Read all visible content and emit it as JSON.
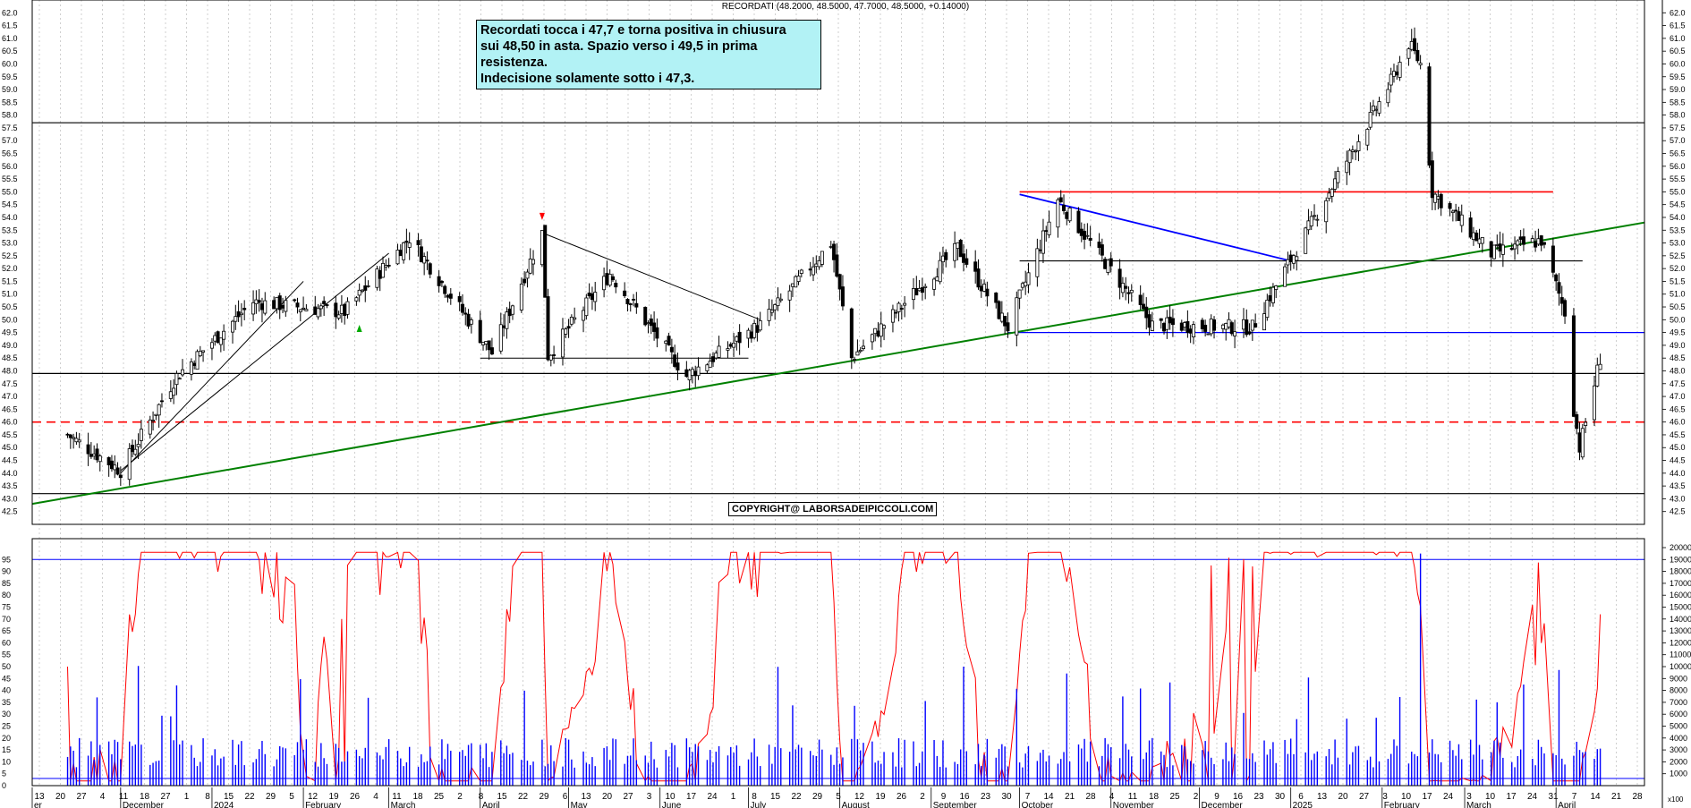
{
  "header": {
    "ohlc_line": "RECORDATI (48.2000, 48.5000, 47.7000, 48.5000, +0.14000)"
  },
  "annotation": {
    "lines": [
      "Recordati tocca i 47,7 e torna positiva in chiusura",
      "sui 48,50 in asta. Spazio verso i 49,5 in prima",
      "resistenza.",
      "Indecisione solamente sotto i 47,3."
    ]
  },
  "copyright": "COPYRIGHT@ LABORSADEIPICCOLI.COM",
  "colors": {
    "price_bars": "#000000",
    "green_trend": "#008000",
    "blue_lines": "#0000ff",
    "red_lines": "#ff0000",
    "oscillator": "#ff0000",
    "volume": "#0000ff",
    "annotation_bg": "#b2f2f5"
  },
  "chart_data": [
    {
      "type": "ohlc",
      "name": "RECORDATI",
      "ylim": [
        42.0,
        62.5
      ],
      "yticks": [
        "42.5",
        "43.0",
        "43.5",
        "44.0",
        "44.5",
        "45.0",
        "45.5",
        "46.0",
        "46.5",
        "47.0",
        "47.5",
        "48.0",
        "48.5",
        "49.0",
        "49.5",
        "50.0",
        "50.5",
        "51.0",
        "51.5",
        "52.0",
        "52.5",
        "53.0",
        "53.5",
        "54.0",
        "54.5",
        "55.0",
        "55.5",
        "56.0",
        "56.5",
        "57.0",
        "57.5",
        "58.0",
        "58.5",
        "59.0",
        "59.5",
        "60.0",
        "60.5",
        "61.0",
        "61.5",
        "62.0"
      ],
      "x_day_labels": [
        "13",
        "20",
        "27",
        "4",
        "11",
        "18",
        "27",
        "1",
        "8",
        "15",
        "22",
        "29",
        "5",
        "12",
        "19",
        "26",
        "4",
        "11",
        "18",
        "25",
        "2",
        "8",
        "15",
        "22",
        "29",
        "6",
        "13",
        "20",
        "27",
        "3",
        "10",
        "17",
        "24",
        "1",
        "8",
        "15",
        "22",
        "29",
        "5",
        "12",
        "19",
        "26",
        "2",
        "9",
        "16",
        "23",
        "30",
        "7",
        "14",
        "21",
        "28",
        "4",
        "11",
        "18",
        "25",
        "2",
        "9",
        "16",
        "23",
        "30",
        "6",
        "13",
        "20",
        "27",
        "3",
        "10",
        "17",
        "24",
        "3",
        "10",
        "17",
        "24",
        "31",
        "7",
        "14",
        "21",
        "28"
      ],
      "x_month_labels": [
        "er",
        "December",
        "2024",
        "February",
        "March",
        "April",
        "May",
        "June",
        "July",
        "August",
        "September",
        "October",
        "November",
        "December",
        "2025",
        "February",
        "March",
        "April"
      ],
      "keypoints": [
        {
          "date": "Nov 13 2023",
          "close": 45.5
        },
        {
          "date": "Dec 1 2023",
          "close": 44.1
        },
        {
          "date": "Dec 20 2023",
          "close": 47.8
        },
        {
          "date": "Jan 15 2024",
          "close": 50.7
        },
        {
          "date": "Feb 15 2024",
          "close": 50.3
        },
        {
          "date": "Mar 8 2024",
          "close": 53.2
        },
        {
          "date": "Apr 5 2024",
          "close": 48.7
        },
        {
          "date": "Apr 22 2024",
          "close": 53.4
        },
        {
          "date": "Apr 24 2024",
          "close": 48.6
        },
        {
          "date": "May 15 2024",
          "close": 51.8
        },
        {
          "date": "Jun 10 2024",
          "close": 47.8
        },
        {
          "date": "Jul 5 2024",
          "close": 49.8
        },
        {
          "date": "Jul 29 2024",
          "close": 53.0
        },
        {
          "date": "Aug 5 2024",
          "close": 48.5
        },
        {
          "date": "Sep 10 2024",
          "close": 52.8
        },
        {
          "date": "Sep 27 2024",
          "close": 49.7
        },
        {
          "date": "Oct 14 2024",
          "close": 54.7
        },
        {
          "date": "Nov 15 2024",
          "close": 49.8
        },
        {
          "date": "Dec 19 2024",
          "close": 49.7
        },
        {
          "date": "Jan 14 2025",
          "close": 55.0
        },
        {
          "date": "Feb 4 2025",
          "close": 59.3
        },
        {
          "date": "Feb 10 2025",
          "close": 60.8
        },
        {
          "date": "Feb 14 2025",
          "close": 60.0
        },
        {
          "date": "Feb 18 2025",
          "close": 55.0
        },
        {
          "date": "Mar 10 2025",
          "close": 52.6
        },
        {
          "date": "Mar 27 2025",
          "close": 53.1
        },
        {
          "date": "Apr 4 2025",
          "close": 50.3
        },
        {
          "date": "Apr 7 2025",
          "close": 46.5
        },
        {
          "date": "Apr 9 2025",
          "close": 45.0
        },
        {
          "date": "Apr 16 2025",
          "close": 48.5
        }
      ],
      "horizontal_levels": [
        {
          "value": 57.7,
          "color": "black",
          "style": "solid"
        },
        {
          "value": 49.5,
          "color": "blue",
          "style": "solid"
        },
        {
          "value": 47.9,
          "color": "black",
          "style": "solid"
        },
        {
          "value": 46.0,
          "color": "red",
          "style": "dashed"
        },
        {
          "value": 43.2,
          "color": "black",
          "style": "solid"
        },
        {
          "value": 55.0,
          "color": "red",
          "style": "solid"
        },
        {
          "value": 52.3,
          "color": "black",
          "style": "solid"
        }
      ],
      "trendlines": [
        {
          "color": "green",
          "from": [
            "Nov 2023",
            42.8
          ],
          "to": [
            "Apr 2025",
            53.8
          ]
        },
        {
          "color": "blue",
          "from": [
            "Oct 2024",
            54.9
          ],
          "to": [
            "Jan 2025",
            52.3
          ]
        },
        {
          "color": "black",
          "from": [
            "Apr 22 2024",
            53.4
          ],
          "to": [
            "Jul 5 2024",
            50.0
          ]
        },
        {
          "color": "black",
          "from": [
            "Dec 1 2023",
            44.0
          ],
          "to": [
            "Feb 2024",
            51.5
          ]
        },
        {
          "color": "black",
          "from": [
            "Dec 1 2023",
            44.1
          ],
          "to": [
            "Mar 2024",
            52.6
          ]
        }
      ]
    },
    {
      "type": "line",
      "name": "oscillator",
      "ylim": [
        0,
        100
      ],
      "yticks": [
        "0",
        "5",
        "10",
        "15",
        "20",
        "25",
        "30",
        "35",
        "40",
        "45",
        "50",
        "55",
        "60",
        "65",
        "70",
        "75",
        "80",
        "85",
        "90",
        "95"
      ],
      "reference_lines": [
        95,
        3
      ],
      "last_value": 72
    },
    {
      "type": "bar",
      "name": "volume",
      "ylim": [
        0,
        20000
      ],
      "yticks": [
        "1000",
        "2000",
        "3000",
        "4000",
        "5000",
        "6000",
        "7000",
        "8000",
        "9000",
        "10000",
        "11000",
        "12000",
        "13000",
        "14000",
        "15000",
        "16000",
        "17000",
        "18000",
        "19000",
        "20000"
      ],
      "axis_unit": "x100",
      "peak": 19500
    }
  ]
}
